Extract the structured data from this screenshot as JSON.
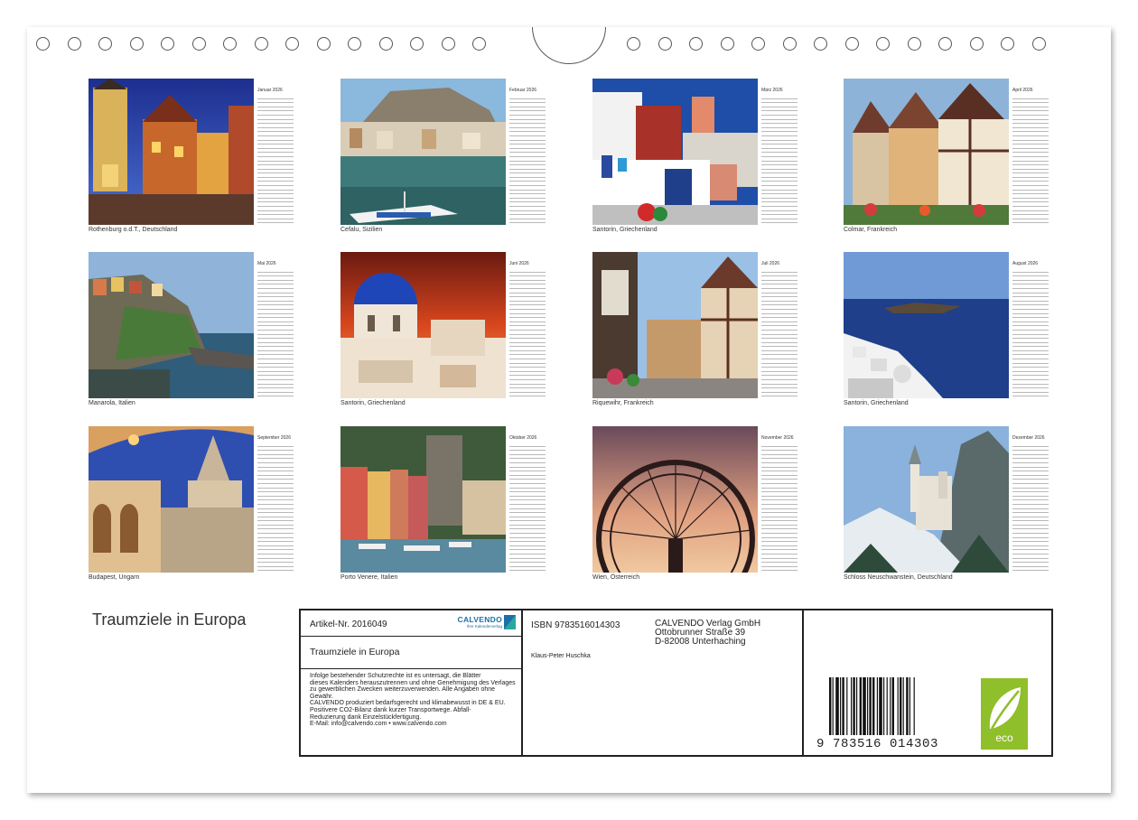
{
  "calendar": {
    "months": [
      {
        "name": "Januar",
        "year": "2026",
        "caption": "Rothenburg o.d.T., Deutschland"
      },
      {
        "name": "Februar",
        "year": "2026",
        "caption": "Cefalu, Sizilien"
      },
      {
        "name": "März",
        "year": "2026",
        "caption": "Santorin, Griechenland"
      },
      {
        "name": "April",
        "year": "2026",
        "caption": "Colmar, Frankreich"
      },
      {
        "name": "Mai",
        "year": "2026",
        "caption": "Manarola, Italien"
      },
      {
        "name": "Juni",
        "year": "2026",
        "caption": "Santorin, Griechenland"
      },
      {
        "name": "Juli",
        "year": "2026",
        "caption": "Riquewihr, Frankreich"
      },
      {
        "name": "August",
        "year": "2026",
        "caption": "Santorin, Griechenland"
      },
      {
        "name": "September",
        "year": "2026",
        "caption": "Budapest, Ungarn"
      },
      {
        "name": "Oktober",
        "year": "2026",
        "caption": "Porto Venere, Italien"
      },
      {
        "name": "November",
        "year": "2026",
        "caption": "Wien, Österreich"
      },
      {
        "name": "Dezember",
        "year": "2026",
        "caption": "Schloss Neuschwanstein, Deutschland"
      }
    ]
  },
  "cover_title": "Traumziele in Europa",
  "info": {
    "artikel": "Artikel-Nr. 2016049",
    "logo_text": "CALVENDO",
    "logo_sub": "Ihre Kalenderverlag",
    "subtitle": "Traumziele in Europa",
    "notice": [
      "Infolge bestehender Schutzrechte ist es untersagt, die Blätter",
      "dieses Kalenders herauszutrennen und ohne Genehmigung des Verlages",
      "zu gewerblichen Zwecken weiterzuverwenden. Alle Angaben ohne",
      "Gewähr.",
      "CALVENDO produziert bedarfsgerecht und klimabewusst in DE & EU.",
      "Positivere CO2-Bilanz dank kurzer Transportwege. Abfall-",
      "Reduzierung dank Einzelstückfertigung.",
      "E-Mail: info@calvendo.com • www.calvendo.com"
    ],
    "isbn": "ISBN 9783516014303",
    "publisher": [
      "CALVENDO Verlag GmbH",
      "Ottobrunner Straße 39",
      "D-82008 Unterhaching"
    ],
    "author": "Klaus-Peter Huschka",
    "barcode_number": "9 783516 014303",
    "eco_label": "eco"
  },
  "colors": {
    "eco_green": "#8fbf2a",
    "logo_blue": "#1e6fa8"
  }
}
